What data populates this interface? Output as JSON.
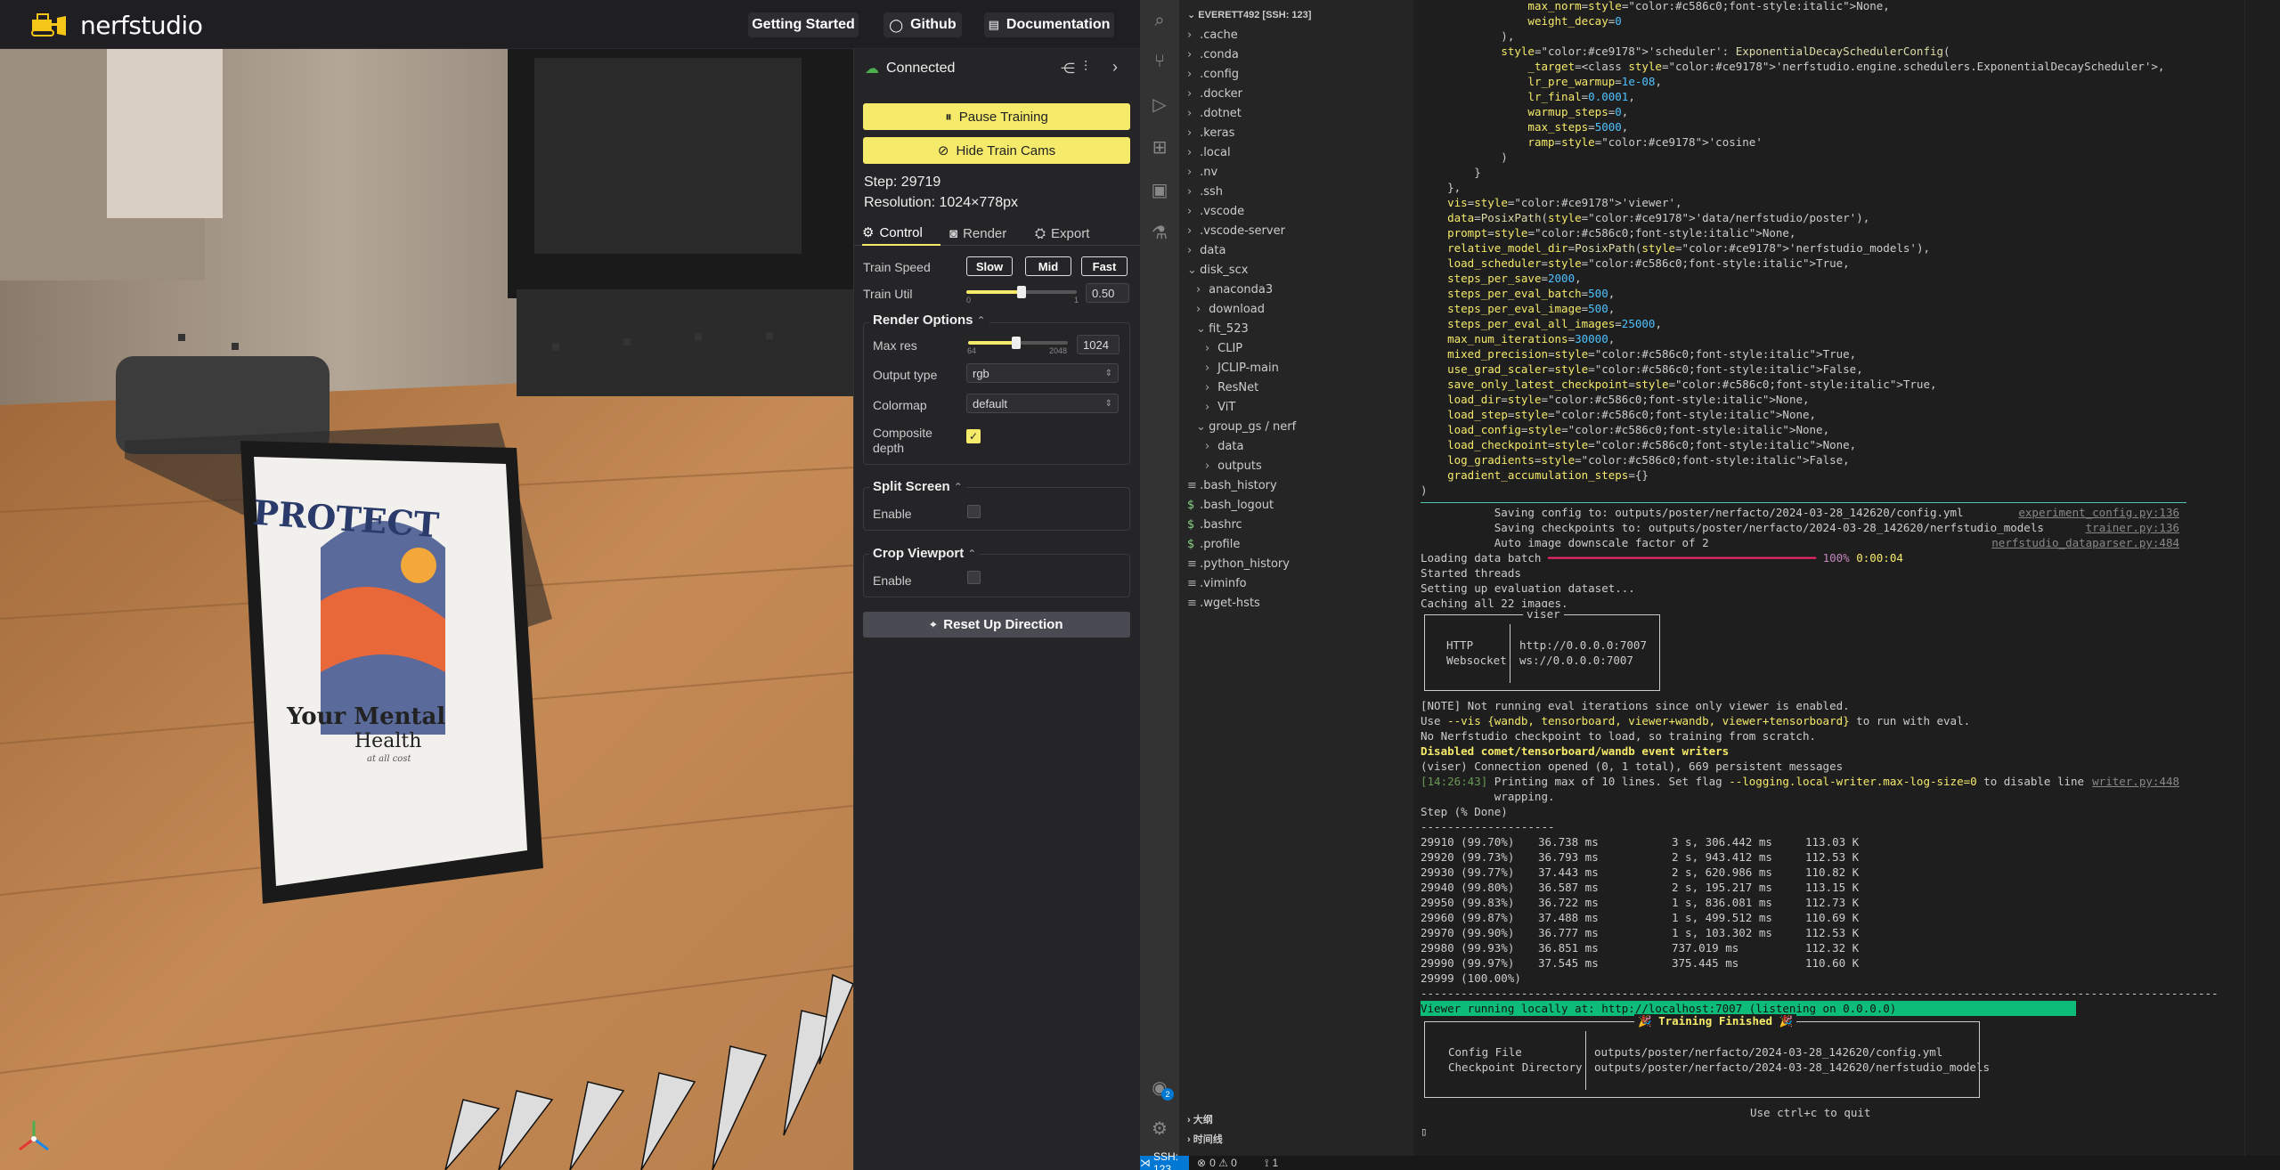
{
  "nerfstudio": {
    "logo_text": "nerfstudio",
    "top_buttons": {
      "getting_started": "Getting Started",
      "github": "Github",
      "documentation": "Documentation"
    },
    "connection_status": "Connected",
    "pause_training": "Pause Training",
    "hide_train_cams": "Hide Train Cams",
    "step": "Step: 29719",
    "resolution": "Resolution: 1024×778px",
    "tabs": {
      "control": "Control",
      "render": "Render",
      "export": "Export"
    },
    "train_speed_label": "Train Speed",
    "speed_buttons": {
      "slow": "Slow",
      "mid": "Mid",
      "fast": "Fast"
    },
    "train_util_label": "Train Util",
    "train_util": {
      "value": "0.50",
      "min": "0",
      "max": "1",
      "fraction": 0.5
    },
    "render_options": {
      "title": "Render Options",
      "max_res_label": "Max res",
      "max_res": {
        "value": "1024",
        "min": "64",
        "max": "2048",
        "fraction": 0.48
      },
      "output_type_label": "Output type",
      "output_type": "rgb",
      "colormap_label": "Colormap",
      "colormap": "default",
      "composite_depth_label": "Composite depth",
      "composite_depth_checked": true
    },
    "split_screen": {
      "title": "Split Screen",
      "enable_label": "Enable"
    },
    "crop_viewport": {
      "title": "Crop Viewport",
      "enable_label": "Enable"
    },
    "reset_up": "Reset Up Direction",
    "poster": {
      "line1": "PROTECT",
      "line2": "Your Mental",
      "line3": "Health",
      "line4": "at all cost"
    },
    "colors": {
      "accent_yellow": "#f5ea6a",
      "connected_green": "#4caf50"
    }
  },
  "vscode": {
    "explorer_root": "EVERETT492 [SSH: 123]",
    "tree": [
      {
        "label": ".cache",
        "depth": 0,
        "type": "folder"
      },
      {
        "label": ".conda",
        "depth": 0,
        "type": "folder"
      },
      {
        "label": ".config",
        "depth": 0,
        "type": "folder"
      },
      {
        "label": ".docker",
        "depth": 0,
        "type": "folder"
      },
      {
        "label": ".dotnet",
        "depth": 0,
        "type": "folder"
      },
      {
        "label": ".keras",
        "depth": 0,
        "type": "folder"
      },
      {
        "label": ".local",
        "depth": 0,
        "type": "folder"
      },
      {
        "label": ".nv",
        "depth": 0,
        "type": "folder"
      },
      {
        "label": ".ssh",
        "depth": 0,
        "type": "folder"
      },
      {
        "label": ".vscode",
        "depth": 0,
        "type": "folder"
      },
      {
        "label": ".vscode-server",
        "depth": 0,
        "type": "folder"
      },
      {
        "label": "data",
        "depth": 0,
        "type": "folder"
      },
      {
        "label": "disk_scx",
        "depth": 0,
        "type": "open"
      },
      {
        "label": "anaconda3",
        "depth": 1,
        "type": "folder"
      },
      {
        "label": "download",
        "depth": 1,
        "type": "folder"
      },
      {
        "label": "fit_523",
        "depth": 1,
        "type": "open"
      },
      {
        "label": "CLIP",
        "depth": 2,
        "type": "folder"
      },
      {
        "label": "JCLIP-main",
        "depth": 2,
        "type": "folder"
      },
      {
        "label": "ResNet",
        "depth": 2,
        "type": "folder"
      },
      {
        "label": "ViT",
        "depth": 2,
        "type": "folder"
      },
      {
        "label": "group_gs / nerf",
        "depth": 1,
        "type": "open"
      },
      {
        "label": "data",
        "depth": 2,
        "type": "folder"
      },
      {
        "label": "outputs",
        "depth": 2,
        "type": "folder"
      },
      {
        "label": ".bash_history",
        "depth": 0,
        "type": "file"
      },
      {
        "label": ".bash_logout",
        "depth": 0,
        "type": "shell"
      },
      {
        "label": ".bashrc",
        "depth": 0,
        "type": "shell"
      },
      {
        "label": ".profile",
        "depth": 0,
        "type": "shell"
      },
      {
        "label": ".python_history",
        "depth": 0,
        "type": "file"
      },
      {
        "label": ".viminfo",
        "depth": 0,
        "type": "file"
      },
      {
        "label": ".wget-hsts",
        "depth": 0,
        "type": "file"
      }
    ],
    "outline": "大纲",
    "timeline": "时间线",
    "status": {
      "remote": "SSH: 123",
      "problems": "0 ⚠ 0",
      "ports": "1"
    },
    "account_badge": "2",
    "terminal_lines": [
      {
        "t": "                max_norm=None,"
      },
      {
        "t": "                weight_decay=0"
      },
      {
        "t": "            ),"
      },
      {
        "t": "            'scheduler': ExponentialDecaySchedulerConfig("
      },
      {
        "t": "                _target=<class 'nerfstudio.engine.schedulers.ExponentialDecayScheduler'>,"
      },
      {
        "t": "                lr_pre_warmup=1e-08,"
      },
      {
        "t": "                lr_final=0.0001,"
      },
      {
        "t": "                warmup_steps=0,"
      },
      {
        "t": "                max_steps=5000,"
      },
      {
        "t": "                ramp='cosine'"
      },
      {
        "t": "            )"
      },
      {
        "t": "        }"
      },
      {
        "t": "    },"
      },
      {
        "t": "    vis='viewer',"
      },
      {
        "t": "    data=PosixPath('data/nerfstudio/poster'),"
      },
      {
        "t": "    prompt=None,"
      },
      {
        "t": "    relative_model_dir=PosixPath('nerfstudio_models'),"
      },
      {
        "t": "    load_scheduler=True,"
      },
      {
        "t": "    steps_per_save=2000,"
      },
      {
        "t": "    steps_per_eval_batch=500,"
      },
      {
        "t": "    steps_per_eval_image=500,"
      },
      {
        "t": "    steps_per_eval_all_images=25000,"
      },
      {
        "t": "    max_num_iterations=30000,"
      },
      {
        "t": "    mixed_precision=True,"
      },
      {
        "t": "    use_grad_scaler=False,"
      },
      {
        "t": "    save_only_latest_checkpoint=True,"
      },
      {
        "t": "    load_dir=None,"
      },
      {
        "t": "    load_step=None,"
      },
      {
        "t": "    load_config=None,"
      },
      {
        "t": "    load_checkpoint=None,"
      },
      {
        "t": "    log_gradients=False,"
      },
      {
        "t": "    gradient_accumulation_steps={}"
      },
      {
        "t": ")"
      }
    ],
    "terminal_log": [
      {
        "t": "           Saving config to: outputs/poster/nerfacto/2024-03-28_142620/config.yml",
        "r": "experiment_config.py:136"
      },
      {
        "t": "           Saving checkpoints to: outputs/poster/nerfacto/2024-03-28_142620/nerfstudio_models",
        "r": "trainer.py:136"
      },
      {
        "t": "           Auto image downscale factor of 2",
        "r": "nerfstudio_dataparser.py:484"
      },
      {
        "t": "Loading data batch ━━━━━━━━━━━━━━━━━━━━━━━━━━━━━━━━━━━━━━━━ 100% 0:00:04",
        "r": ""
      },
      {
        "t": "Started threads",
        "r": ""
      },
      {
        "t": "Setting up evaluation dataset...",
        "r": ""
      },
      {
        "t": "Caching all 22 images.",
        "r": ""
      }
    ],
    "viser_box": {
      "title": "viser",
      "http_label": "HTTP",
      "http": "http://0.0.0.0:7007",
      "ws_label": "Websocket",
      "ws": "ws://0.0.0.0:7007"
    },
    "after_viser": [
      {
        "t": "[NOTE] Not running eval iterations since only viewer is enabled.",
        "cls": ""
      },
      {
        "t": "Use --vis {wandb, tensorboard, viewer+wandb, viewer+tensorboard} to run with eval.",
        "cls": ""
      },
      {
        "t": "No Nerfstudio checkpoint to load, so training from scratch.",
        "cls": ""
      },
      {
        "t": "Disabled comet/tensorboard/wandb event writers",
        "cls": "yb"
      },
      {
        "t": "(viser) Connection opened (0, 1 total), 669 persistent messages",
        "cls": ""
      },
      {
        "t": "[14:26:43] Printing max of 10 lines. Set flag --logging.local-writer.max-log-size=0 to disable line",
        "cls": "",
        "r": "writer.py:448"
      },
      {
        "t": "           wrapping.",
        "cls": ""
      },
      {
        "t": "Step (% Done)",
        "cls": ""
      },
      {
        "t": "--------------------",
        "cls": ""
      }
    ],
    "step_table": [
      {
        "step": "29910 (99.70%)",
        "iter": "36.738 ms",
        "eta": "3 s, 306.442 ms",
        "rays": "113.03 K"
      },
      {
        "step": "29920 (99.73%)",
        "iter": "36.793 ms",
        "eta": "2 s, 943.412 ms",
        "rays": "112.53 K"
      },
      {
        "step": "29930 (99.77%)",
        "iter": "37.443 ms",
        "eta": "2 s, 620.986 ms",
        "rays": "110.82 K"
      },
      {
        "step": "29940 (99.80%)",
        "iter": "36.587 ms",
        "eta": "2 s, 195.217 ms",
        "rays": "113.15 K"
      },
      {
        "step": "29950 (99.83%)",
        "iter": "36.722 ms",
        "eta": "1 s, 836.081 ms",
        "rays": "112.73 K"
      },
      {
        "step": "29960 (99.87%)",
        "iter": "37.488 ms",
        "eta": "1 s, 499.512 ms",
        "rays": "110.69 K"
      },
      {
        "step": "29970 (99.90%)",
        "iter": "36.777 ms",
        "eta": "1 s, 103.302 ms",
        "rays": "112.53 K"
      },
      {
        "step": "29980 (99.93%)",
        "iter": "36.851 ms",
        "eta": "737.019 ms",
        "rays": "112.32 K"
      },
      {
        "step": "29990 (99.97%)",
        "iter": "37.545 ms",
        "eta": "375.445 ms",
        "rays": "110.60 K"
      },
      {
        "step": "29999 (100.00%)",
        "iter": "",
        "eta": "",
        "rays": ""
      }
    ],
    "dashes": "-----------------------------------------------------------------------------------------------------------------------",
    "viewer_running": "Viewer running locally at: http://localhost:7007 (listening on 0.0.0.0)",
    "training_finished": "🎉 Training Finished 🎉",
    "config_file_label": "Config File",
    "config_file": "outputs/poster/nerfacto/2024-03-28_142620/config.yml",
    "checkpoint_dir_label": "Checkpoint Directory",
    "checkpoint_dir": "outputs/poster/nerfacto/2024-03-28_142620/nerfstudio_models",
    "quit_hint": "Use ctrl+c to quit"
  }
}
